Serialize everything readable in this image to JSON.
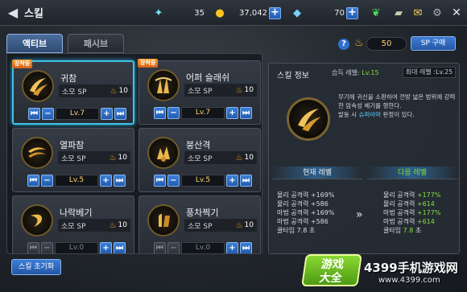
{
  "header": {
    "title": "스킬",
    "back_glyph": "◀"
  },
  "currencies": [
    {
      "icon": "feather-icon",
      "value": "35"
    },
    {
      "icon": "gold-coin-icon",
      "value": "37,042"
    },
    {
      "icon": "blue-gem-icon",
      "value": "70"
    }
  ],
  "tabs": [
    {
      "label": "액티브"
    },
    {
      "label": "패시브"
    }
  ],
  "sp": {
    "help": "?",
    "value": "50",
    "buy_label": "SP 구매"
  },
  "skills": [
    {
      "name": "귀참",
      "cost_label": "소모 SP",
      "cost": "10",
      "level": "Lv.7",
      "badge": "장착중",
      "selected": true
    },
    {
      "name": "어퍼 슬래쉬",
      "cost_label": "소모 SP",
      "cost": "10",
      "level": "Lv.7",
      "badge": "장착중",
      "selected": false
    },
    {
      "name": "열파참",
      "cost_label": "소모 SP",
      "cost": "10",
      "level": "Lv.5",
      "badge": "",
      "selected": false
    },
    {
      "name": "붕산격",
      "cost_label": "소모 SP",
      "cost": "10",
      "level": "Lv.5",
      "badge": "",
      "selected": false
    },
    {
      "name": "나락베기",
      "cost_label": "소모 SP",
      "cost": "10",
      "level": "Lv.0",
      "badge": "",
      "selected": false
    },
    {
      "name": "풍차찍기",
      "cost_label": "소모 SP",
      "cost": "10",
      "level": "Lv.0",
      "badge": "",
      "selected": false
    }
  ],
  "info": {
    "title": "스킬 정보",
    "learn_label": "습득 레벨:",
    "learn_value": "Lv.15",
    "max_level": "최대 레벨 :Lv.25",
    "desc_line1": "무기에 귀신을 소환하여 전방 넓은 범위에 강력한 암속성 베기를 행한다.",
    "desc_line2_pre": "발동 시 ",
    "desc_line2_hl": "슈퍼아머",
    "desc_line2_post": " 판정이 있다.",
    "current_header": "현재 레벨",
    "next_header": "다음 레벨",
    "current_stats": [
      "물리 공격력 +169%",
      "물리 공격력 +586",
      "마법 공격력 +169%",
      "마법 공격력 +586",
      "쿨타임 7.8 초"
    ],
    "next_stats_labels": [
      "물리 공격력 ",
      "물리 공격력 ",
      "마법 공격력 ",
      "마법 공격력 ",
      "쿨타임 "
    ],
    "next_stats_values": [
      "+177%",
      "+614",
      "+177%",
      "+614",
      "7.8"
    ],
    "next_cool_unit": " 초",
    "arrow": "»"
  },
  "reset_label": "스킬 초기화",
  "watermark": {
    "badge_line1": "游戏",
    "badge_line2": "大全",
    "title": "4399手机游戏网",
    "url": "www.4399.com"
  }
}
